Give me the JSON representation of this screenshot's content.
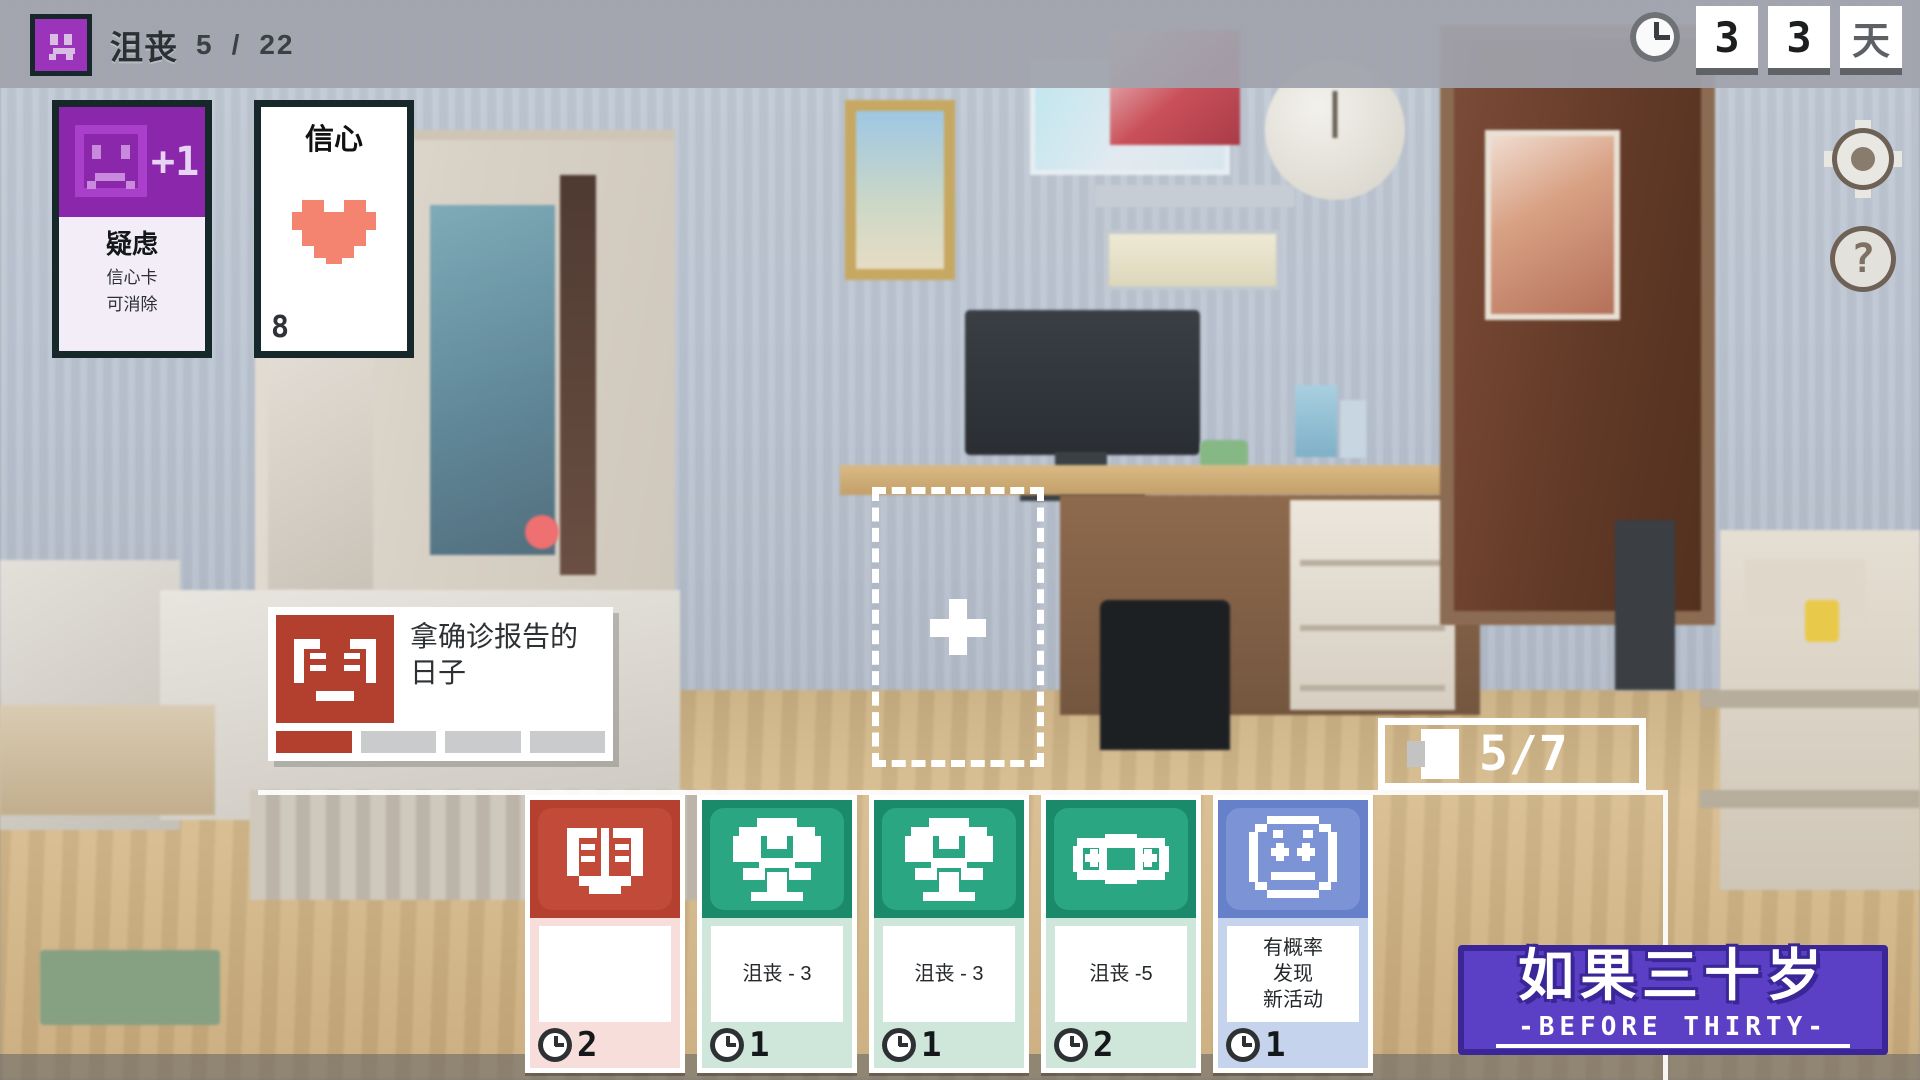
{
  "hud": {
    "mood": {
      "icon": "sad-face-icon",
      "label": "沮丧",
      "current": "5",
      "separator": "/",
      "max": "22"
    },
    "day": {
      "icon": "clock-icon",
      "digit1": "3",
      "digit2": "3",
      "unit": "天"
    }
  },
  "side_buttons": [
    {
      "name": "settings-button",
      "icon": "gear-icon"
    },
    {
      "name": "help-button",
      "icon": "question-mark-icon",
      "glyph": "?"
    }
  ],
  "status_cards": [
    {
      "name": "doubt-card",
      "title": "疑虑",
      "description": "信心卡\n可消除",
      "desc_line1": "信心卡",
      "desc_line2": "可消除",
      "modifier": "+1",
      "icon": "sad-face-icon",
      "color": "#8a27ab"
    },
    {
      "name": "confidence-card",
      "title": "信心",
      "icon": "heart-icon",
      "cost": "8",
      "color": "#f4836f"
    }
  ],
  "event_tooltip": {
    "icon": "red-mask-icon",
    "title_line1": "拿确诊报告的",
    "title_line2": "日子",
    "progress_total": 4,
    "progress_filled": 1,
    "fill_color": "#b3402f"
  },
  "drop_slot": {
    "name": "activity-drop-slot",
    "icon": "plus-icon"
  },
  "deck_counter": {
    "icon": "deck-icon",
    "value": "5/7",
    "current": "5",
    "max": "7"
  },
  "hand_cards": [
    {
      "name": "hand-card-1",
      "color_class": "red",
      "icon": "mask-icon",
      "effect": "",
      "cost": "2"
    },
    {
      "name": "hand-card-2",
      "color_class": "green",
      "icon": "soccer-ball-icon",
      "effect": "沮丧 - 3",
      "cost": "1"
    },
    {
      "name": "hand-card-3",
      "color_class": "green",
      "icon": "soccer-ball-icon",
      "effect": "沮丧 - 3",
      "cost": "1"
    },
    {
      "name": "hand-card-4",
      "color_class": "green",
      "icon": "handheld-console-icon",
      "effect": "沮丧 -5",
      "cost": "2"
    },
    {
      "name": "hand-card-5",
      "color_class": "blue",
      "icon": "dice-face-icon",
      "effect": "有概率\n发现\n新活动",
      "cost": "1"
    }
  ],
  "logo": {
    "cn": "如果三十岁",
    "en": "-BEFORE THIRTY-",
    "color": "#5b3fc4"
  }
}
